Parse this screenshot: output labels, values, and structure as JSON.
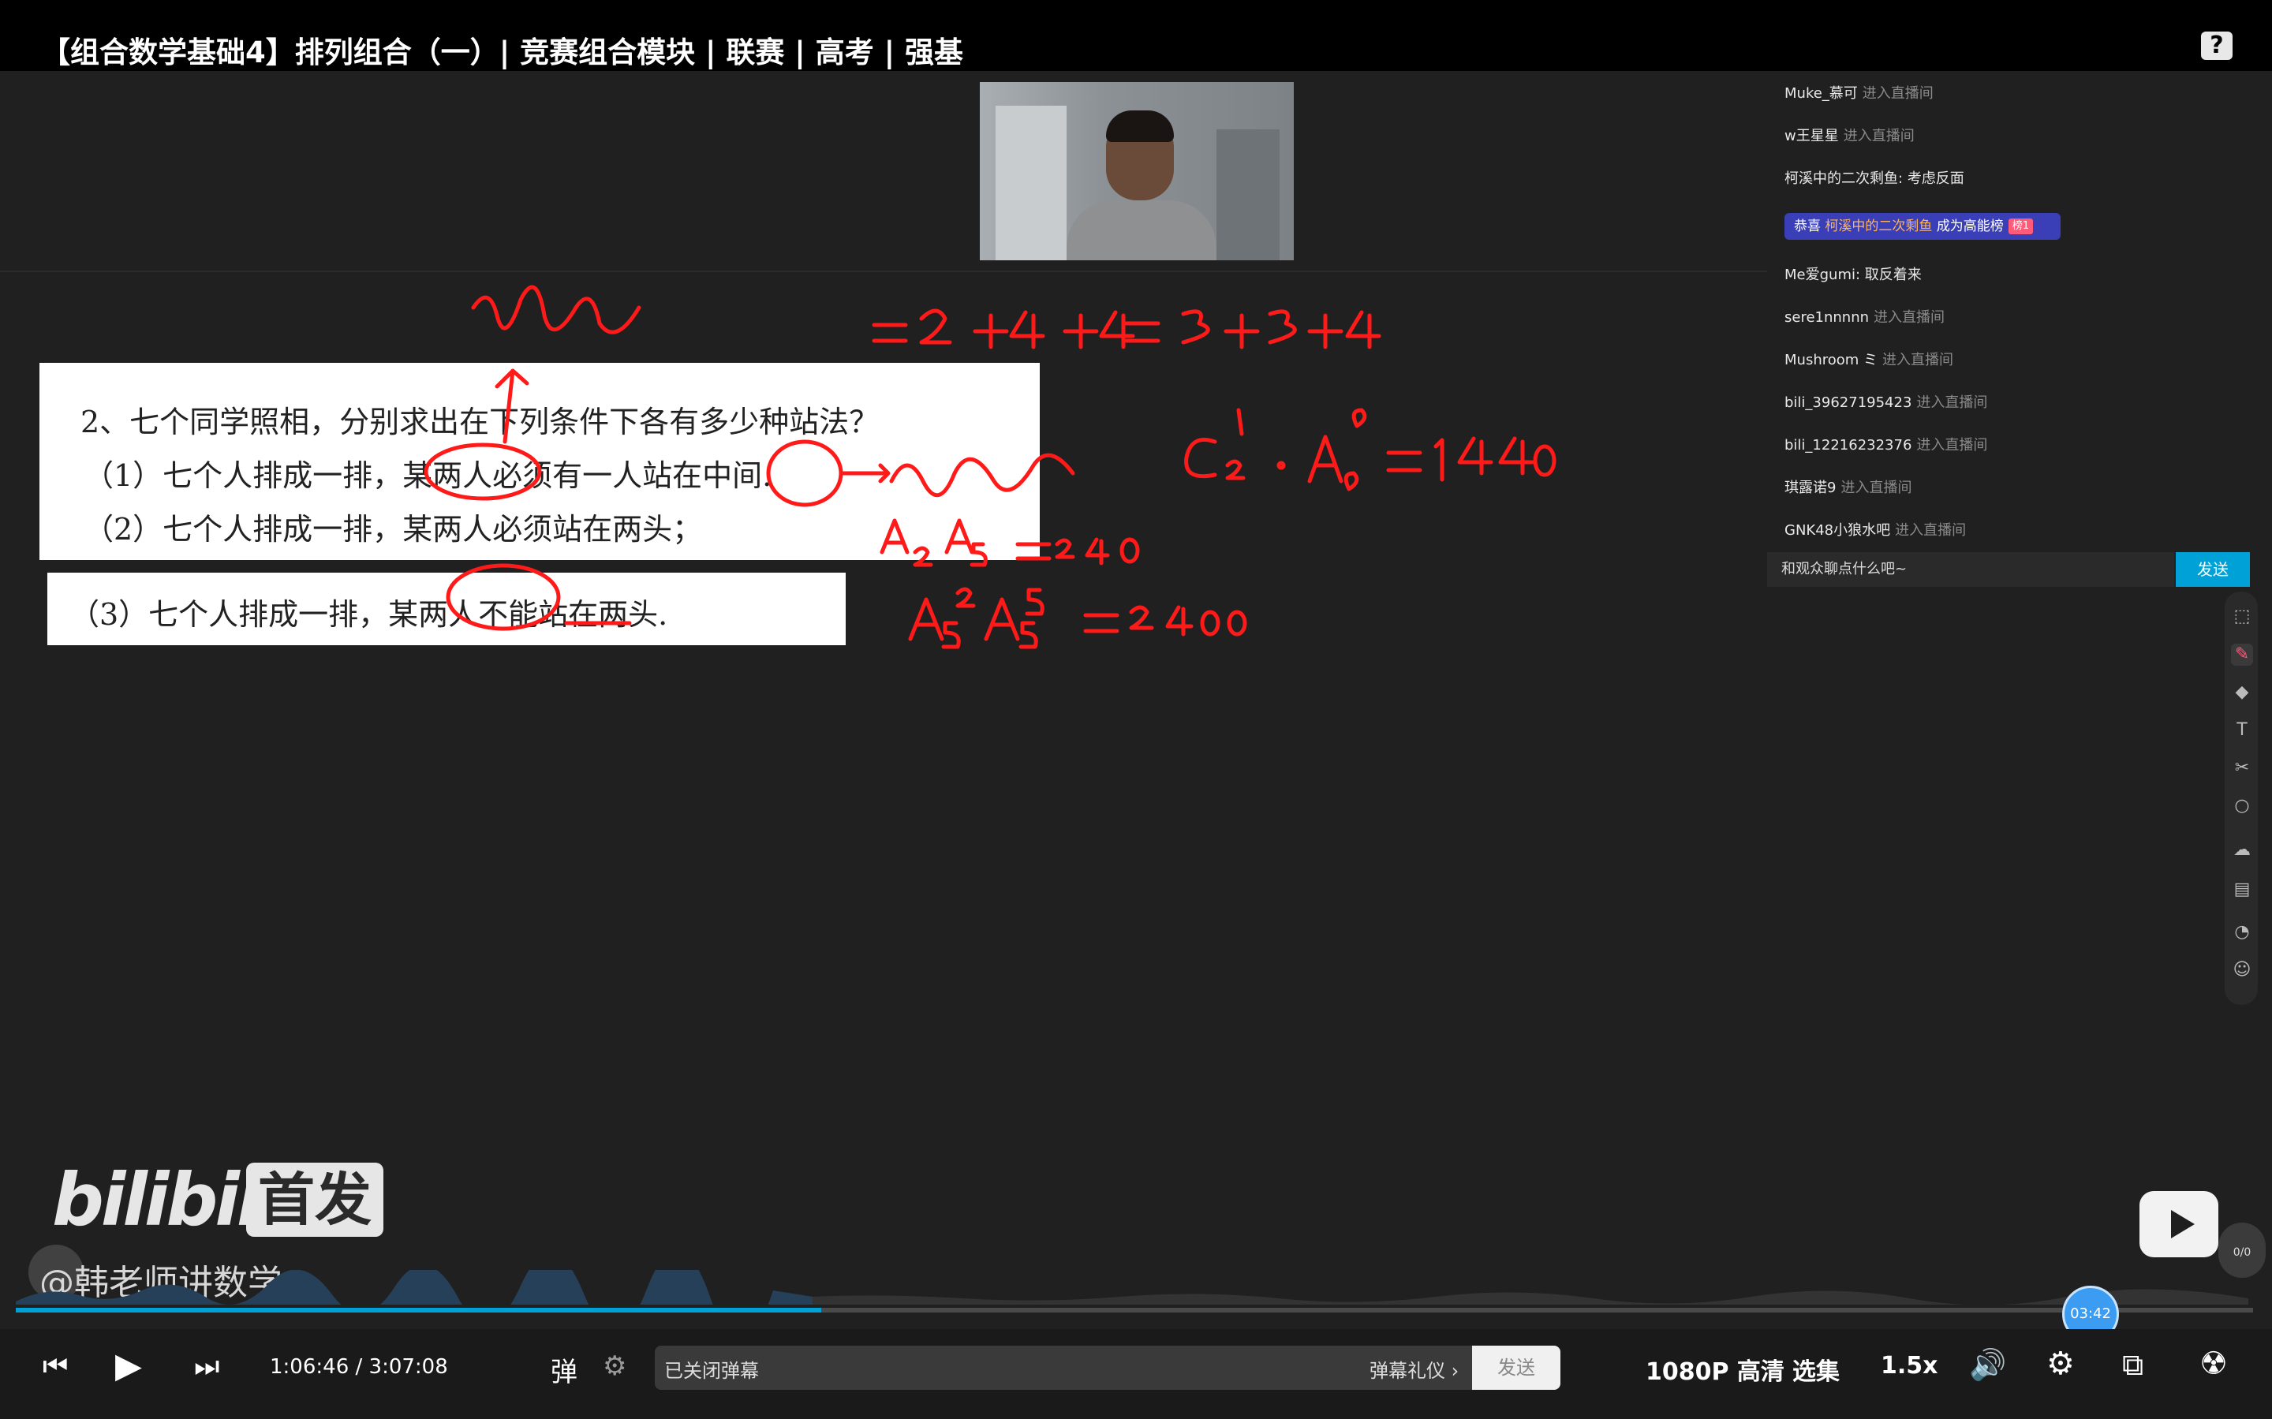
{
  "header": {
    "title": "【组合数学基础4】排列组合（一）| 竞赛组合模块 | 联赛 | 高考 | 强基",
    "help_icon": "help-icon"
  },
  "slides": {
    "problem_line": "2、七个同学照相，分别求出在下列条件下各有多少种站法？",
    "item1": "（1）七个人排成一排，某两人必须有一人站在中间.",
    "item2": "（2）七个人排成一排，某两人必须站在两头；",
    "item3": "（3）七个人排成一排，某两人不能站在两头."
  },
  "chat": {
    "messages": [
      {
        "user": "Muke_慕可",
        "text": "进入直播间",
        "type": "enter"
      },
      {
        "user": "w王星星",
        "text": "进入直播间",
        "type": "enter"
      },
      {
        "user": "柯溪中的二次剩鱼:",
        "text": "考虑反面",
        "type": "msg"
      },
      {
        "user": "Me爱gumi:",
        "text": "取反着来",
        "type": "msg"
      },
      {
        "user": "sere1nnnnn",
        "text": "进入直播间",
        "type": "enter"
      },
      {
        "user": "Mushroom ミ",
        "text": "进入直播间",
        "type": "enter"
      },
      {
        "user": "bili_39627195423",
        "text": "进入直播间",
        "type": "enter"
      },
      {
        "user": "bili_12216232376",
        "text": "进入直播间",
        "type": "enter"
      },
      {
        "user": "琪露诺9",
        "text": "进入直播间",
        "type": "enter"
      },
      {
        "user": "GNK48小狼水吧",
        "text": "进入直播间",
        "type": "enter"
      }
    ],
    "gift": {
      "prefix": "恭喜",
      "user": "柯溪中的二次剩鱼",
      "suffix": "成为高能榜",
      "badge": "榜1"
    },
    "input_placeholder": "和观众聊点什么吧~",
    "send_label": "发送"
  },
  "watermark": {
    "logo": "bilibili",
    "badge": "首发",
    "author": "@韩老师讲数学"
  },
  "side_bubble": "0/0",
  "player": {
    "current_time": "1:06:46",
    "separator": "/",
    "total_time": "3:07:08",
    "hover_time": "03:42",
    "progress": 0.36,
    "danmaku_status": "已关闭弹幕",
    "danmaku_etiquette": "弹幕礼仪 ›",
    "danmaku_send": "发送",
    "quality": "1080P 高清",
    "episodes": "选集",
    "speed": "1.5x",
    "accent_color": "#00a1d6"
  }
}
